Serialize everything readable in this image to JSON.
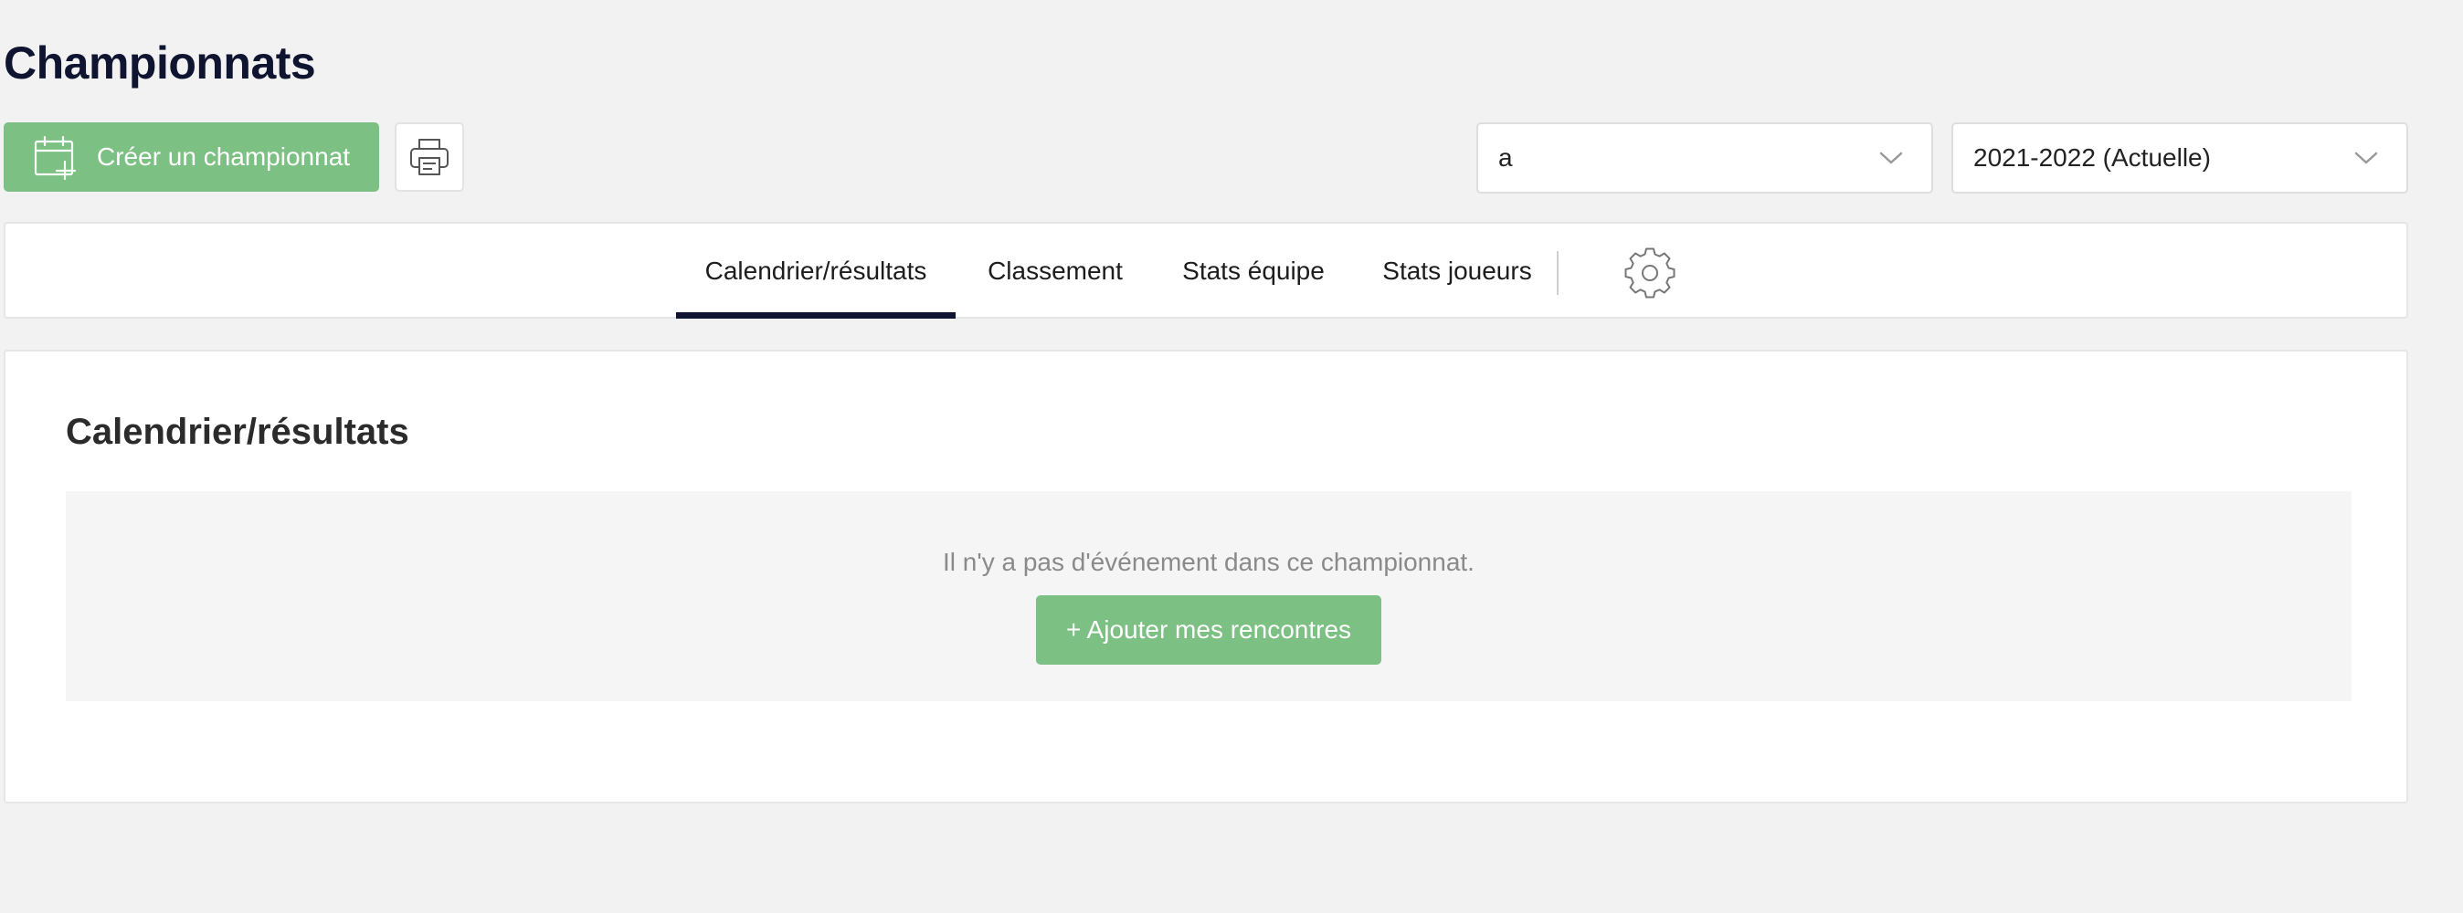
{
  "page": {
    "title": "Championnats"
  },
  "toolbar": {
    "create_label": "Créer un championnat",
    "create_icon": "calendar-plus-icon",
    "print_icon": "printer-icon",
    "team_select": {
      "value": "a",
      "icon": "chevron-down-icon"
    },
    "season_select": {
      "value": "2021-2022 (Actuelle)",
      "icon": "chevron-down-icon"
    }
  },
  "tabs": [
    {
      "label": "Calendrier/résultats",
      "active": true
    },
    {
      "label": "Classement",
      "active": false
    },
    {
      "label": "Stats équipe",
      "active": false
    },
    {
      "label": "Stats joueurs",
      "active": false
    }
  ],
  "settings_icon": "gear-icon",
  "content": {
    "section_title": "Calendrier/résultats",
    "empty_message": "Il n'y a pas d'événement dans ce championnat.",
    "add_button_label": "+ Ajouter mes rencontres"
  },
  "colors": {
    "primary_green": "#7cc083",
    "dark_navy": "#0f1530",
    "background": "#f2f2f2"
  }
}
